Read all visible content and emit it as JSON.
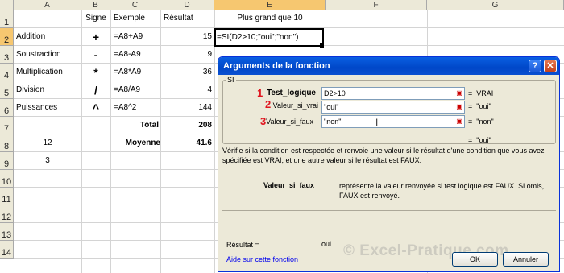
{
  "columns": [
    "A",
    "B",
    "C",
    "D",
    "E",
    "F",
    "G"
  ],
  "rows": [
    "1",
    "2",
    "3",
    "4",
    "5",
    "6",
    "7",
    "8",
    "9",
    "10",
    "11",
    "12",
    "13",
    "14"
  ],
  "headers": {
    "signe": "Signe",
    "exemple": "Exemple",
    "resultat": "Résultat",
    "plus_grand": "Plus grand que 10"
  },
  "ops": [
    {
      "name": "Addition",
      "sign": "+",
      "example": "=A8+A9",
      "result": "15"
    },
    {
      "name": "Soustraction",
      "sign": "-",
      "example": "=A8-A9",
      "result": "9"
    },
    {
      "name": "Multiplication",
      "sign": "*",
      "example": "=A8*A9",
      "result": "36"
    },
    {
      "name": "Division",
      "sign": "/",
      "example": "=A8/A9",
      "result": "4"
    },
    {
      "name": "Puissances",
      "sign": "^",
      "example": "=A8^2",
      "result": "144"
    }
  ],
  "total": {
    "label": "Total",
    "value": "208"
  },
  "moyenne": {
    "label": "Moyenne",
    "value": "41.6"
  },
  "a8": "12",
  "a9": "3",
  "active_formula": "=SI(D2>10;\"oui\";\"non\")",
  "dialog": {
    "title": "Arguments de la fonction",
    "help_btn": "?",
    "close_btn": "✕",
    "group": "SI",
    "args": [
      {
        "num": "1",
        "label": "Test_logique",
        "value": "D2>10",
        "result": "VRAI"
      },
      {
        "num": "2",
        "label": "Valeur_si_vrai",
        "value": "\"oui\"",
        "result": "\"oui\""
      },
      {
        "num": "3",
        "label": "Valeur_si_faux",
        "value": "\"non\"",
        "result": "\"non\""
      }
    ],
    "eq": "=",
    "overall_result": "\"oui\"",
    "description": "Vérifie si la condition est respectée et renvoie une valeur si le résultat d'une condition que vous avez spécifiée est VRAI, et une autre valeur si le résultat est FAUX.",
    "arg_name": "Valeur_si_faux",
    "arg_description": "représente la valeur renvoyée si test logique est FAUX. Si omis, FAUX est renvoyé.",
    "result_label": "Résultat =",
    "result_value": "oui",
    "help_link": "Aide sur cette fonction",
    "ok": "OK",
    "cancel": "Annuler",
    "picker_icon": "range-picker-icon"
  },
  "watermark": "© Excel-Pratique.com"
}
